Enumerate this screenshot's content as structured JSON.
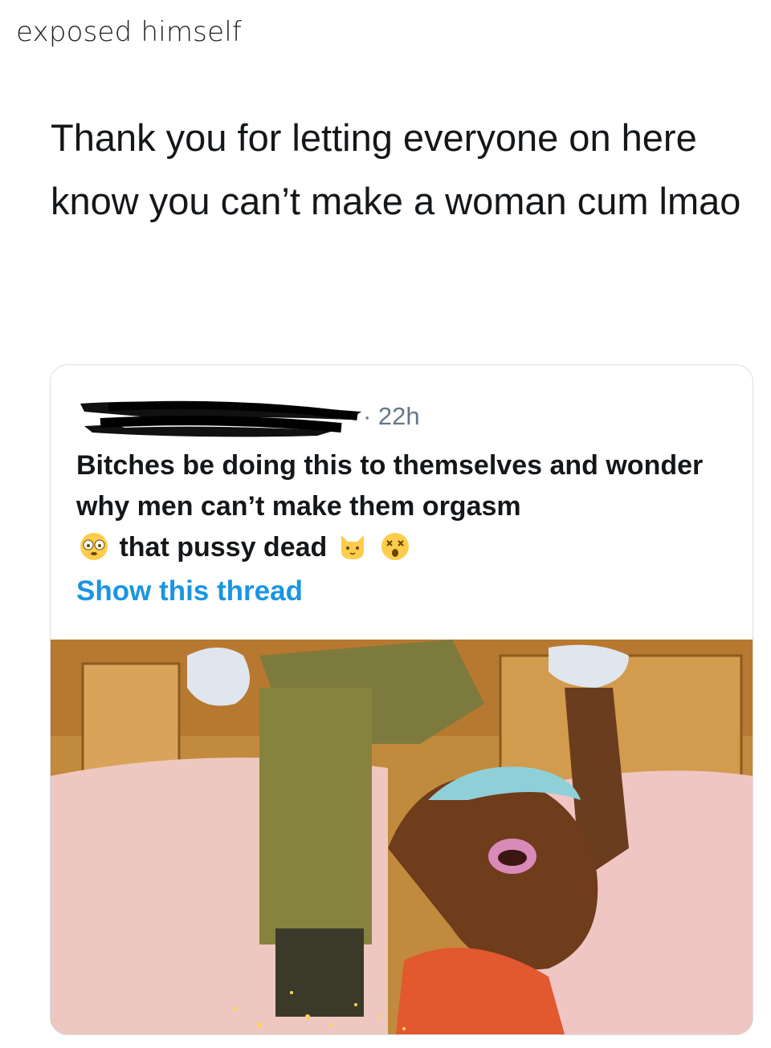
{
  "caption": "exposed himself",
  "tweet": {
    "text": "Thank you for letting everyone on here know you can’t make a woman cum lmao"
  },
  "quoted_tweet": {
    "time": "· 22h",
    "text_part1": "Bitches be doing this to themselves and wonder why men can’t make them orgasm",
    "text_part2": "that pussy dead",
    "emojis": [
      "flushed-face",
      "cat-face",
      "dizzy-face"
    ],
    "show_thread": "Show this thread"
  },
  "colors": {
    "link": "#1b95e0",
    "meta": "#657786",
    "text": "#14171a",
    "border": "#d8dde2"
  }
}
